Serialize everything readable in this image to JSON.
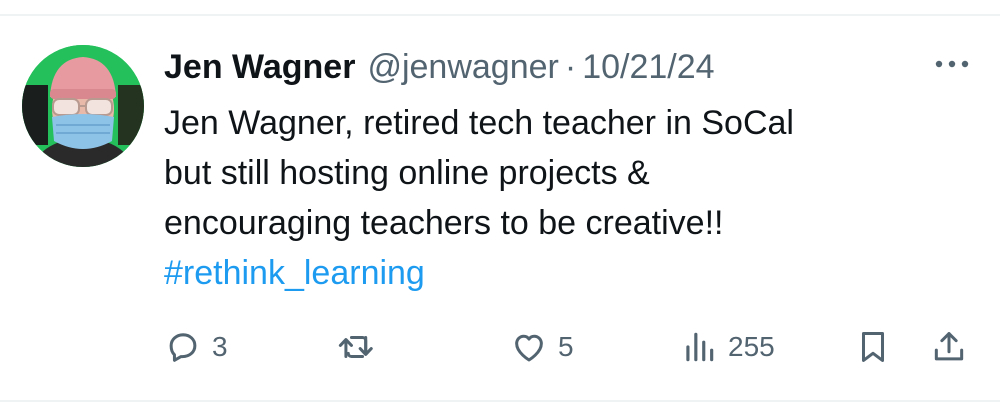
{
  "tweet": {
    "author": {
      "display_name": "Jen Wagner",
      "handle": "@jenwagner",
      "separator": "·",
      "date": "10/21/24",
      "avatar_icon": "profile-photo"
    },
    "text_lines": [
      "Jen Wagner, retired tech teacher in SoCal",
      "but still hosting online projects &",
      "encouraging teachers to be creative!!"
    ],
    "hashtag": "#rethink_learning",
    "actions": {
      "reply": {
        "icon": "reply-icon",
        "count": "3"
      },
      "retweet": {
        "icon": "retweet-icon",
        "count": ""
      },
      "like": {
        "icon": "heart-icon",
        "count": "5"
      },
      "views": {
        "icon": "views-icon",
        "count": "255"
      },
      "bookmark": {
        "icon": "bookmark-icon"
      },
      "share": {
        "icon": "share-icon"
      }
    }
  },
  "colors": {
    "text": "#0f1419",
    "muted": "#536471",
    "accent": "#1d9bf0",
    "divider": "#eff3f4"
  }
}
